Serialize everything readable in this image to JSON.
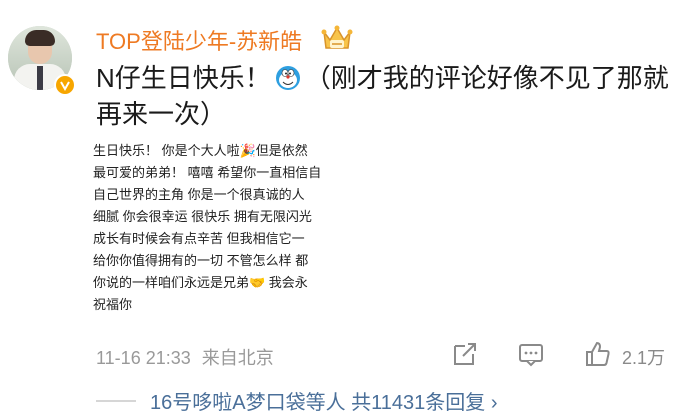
{
  "comment": {
    "username": "TOP登陆少年-苏新皓",
    "text_part1": "N仔生日快乐！",
    "text_part2": "（刚才我的评论好像不见了那就再来一次）",
    "image_lines": [
      "生日快乐！ 你是个大人啦🎉但是依然",
      "最可爱的弟弟！ 嘻嘻 希望你一直相信自",
      "自己世界的主角 你是一个很真诚的人",
      "细腻  你会很幸运 很快乐 拥有无限闪光",
      "成长有时候会有点辛苦 但我相信它一",
      "给你你值得拥有的一切 不管怎么样 都",
      "你说的一样咱们永远是兄弟🤝 我会永",
      "祝福你"
    ],
    "timestamp": "11-16 21:33",
    "location": "来自北京",
    "like_count": "2.1万",
    "reply_summary": "16号哆啦A梦口袋等人 共11431条回复 ›"
  },
  "colors": {
    "username": "#ee7a23",
    "link": "#4a6f99",
    "meta": "#999999",
    "badge": "#f7a600"
  },
  "icons": {
    "inline_emoji": "doraemon-icon",
    "crown": "crown-icon",
    "share": "share-icon",
    "reply": "comment-icon",
    "like": "thumbs-up-icon"
  }
}
